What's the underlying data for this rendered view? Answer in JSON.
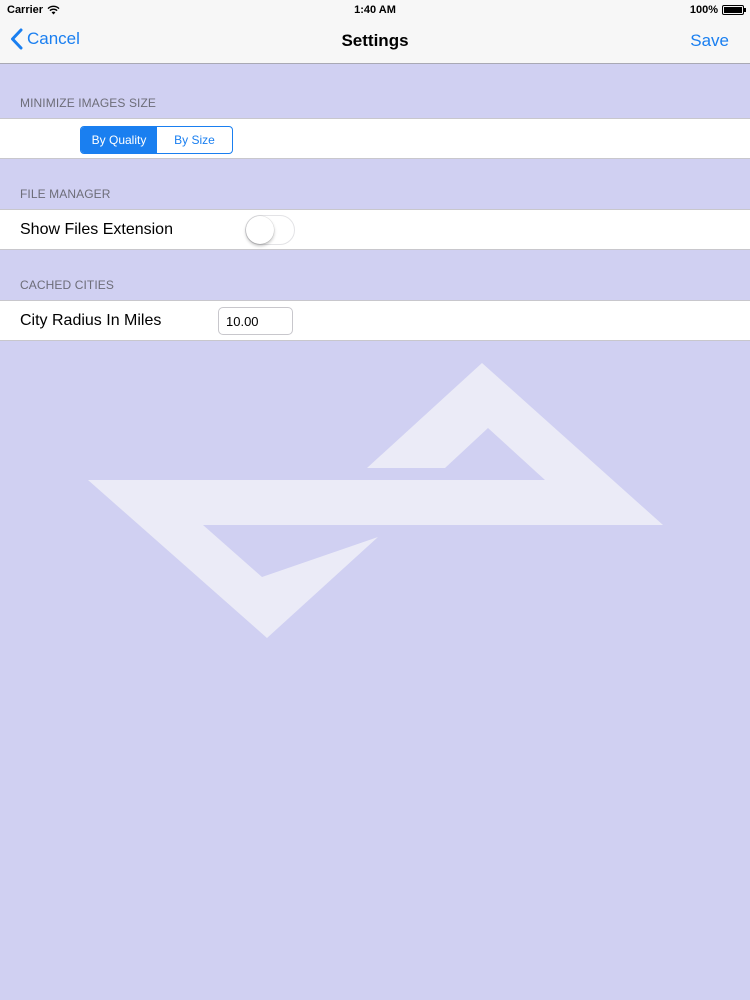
{
  "status_bar": {
    "carrier": "Carrier",
    "time": "1:40 AM",
    "battery_text": "100%",
    "battery_level": 1.0
  },
  "nav": {
    "cancel_label": "Cancel",
    "title": "Settings",
    "save_label": "Save"
  },
  "sections": {
    "images": {
      "header": "MINIMIZE IMAGES SIZE",
      "segments": [
        "By Quality",
        "By Size"
      ],
      "selected_segment": "By Quality"
    },
    "file_manager": {
      "header": "FILE MANAGER",
      "row_label": "Show Files Extension",
      "switch_on": false
    },
    "cached_cities": {
      "header": "CACHED CITIES",
      "row_label": "City Radius In Miles",
      "radius_value": "10.00"
    }
  },
  "colors": {
    "accent": "#1a7ff0",
    "background": "#d0d0f2",
    "logo": "#ebebf7"
  },
  "icons": {
    "back": "chevron-left-icon",
    "wifi": "wifi-icon",
    "battery": "battery-icon",
    "logo": "watermark-logo"
  }
}
